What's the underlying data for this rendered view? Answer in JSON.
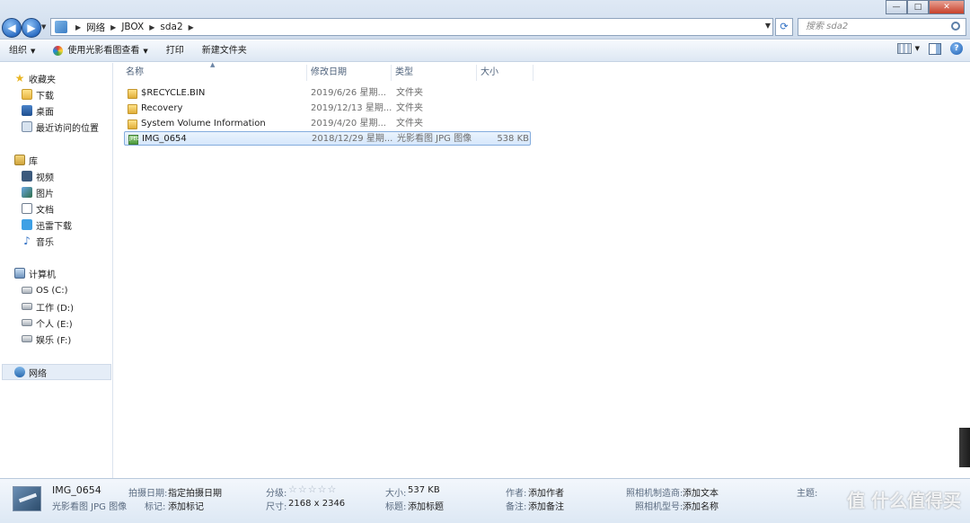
{
  "address": {
    "crumbs": [
      "网络",
      "JBOX",
      "sda2"
    ],
    "search_placeholder": "搜索 sda2"
  },
  "window_controls": {
    "minimize": "—",
    "maximize": "□",
    "close": "✕"
  },
  "toolbar": {
    "organize": "组织",
    "open_with": "使用光影看图查看",
    "print": "打印",
    "new_folder": "新建文件夹"
  },
  "nav": {
    "favorites": "收藏夹",
    "downloads": "下载",
    "desktop": "桌面",
    "recent": "最近访问的位置",
    "libraries": "库",
    "videos": "视频",
    "pictures": "图片",
    "documents": "文档",
    "thunder": "迅雷下载",
    "music": "音乐",
    "computer": "计算机",
    "drive_c": "OS (C:)",
    "drive_d": "工作 (D:)",
    "drive_e": "个人 (E:)",
    "drive_f": "娱乐 (F:)",
    "network": "网络"
  },
  "columns": {
    "name": "名称",
    "date": "修改日期",
    "type": "类型",
    "size": "大小"
  },
  "files": [
    {
      "name": "$RECYCLE.BIN",
      "date": "2019/6/26 星期...",
      "type": "文件夹",
      "size": "",
      "icon": "folder-icon"
    },
    {
      "name": "Recovery",
      "date": "2019/12/13 星期...",
      "type": "文件夹",
      "size": "",
      "icon": "folder-icon"
    },
    {
      "name": "System Volume Information",
      "date": "2019/4/20 星期...",
      "type": "文件夹",
      "size": "",
      "icon": "folder-icon"
    },
    {
      "name": "IMG_0654",
      "date": "2018/12/29 星期...",
      "type": "光影看图 JPG 图像",
      "size": "538 KB",
      "icon": "jpg-file-icon"
    }
  ],
  "details": {
    "filename": "IMG_0654",
    "filetype": "光影看图 JPG 图像",
    "date_taken_label": "拍摄日期:",
    "date_taken_value": "指定拍摄日期",
    "tags_label": "标记:",
    "tags_value": "添加标记",
    "rating_label": "分级:",
    "rating_stars": "☆☆☆☆☆",
    "dimensions_label": "尺寸:",
    "dimensions_value": "2168 x 2346",
    "size_label": "大小:",
    "size_value": "537 KB",
    "title_label": "标题:",
    "title_value": "添加标题",
    "author_label": "作者:",
    "author_value": "添加作者",
    "comments_label": "备注:",
    "comments_value": "添加备注",
    "camera_maker_label": "照相机制造商:",
    "camera_maker_value": "添加文本",
    "camera_model_label": "照相机型号:",
    "camera_model_value": "添加名称",
    "subject_label": "主题:",
    "watermark": "值 什么值得买"
  }
}
